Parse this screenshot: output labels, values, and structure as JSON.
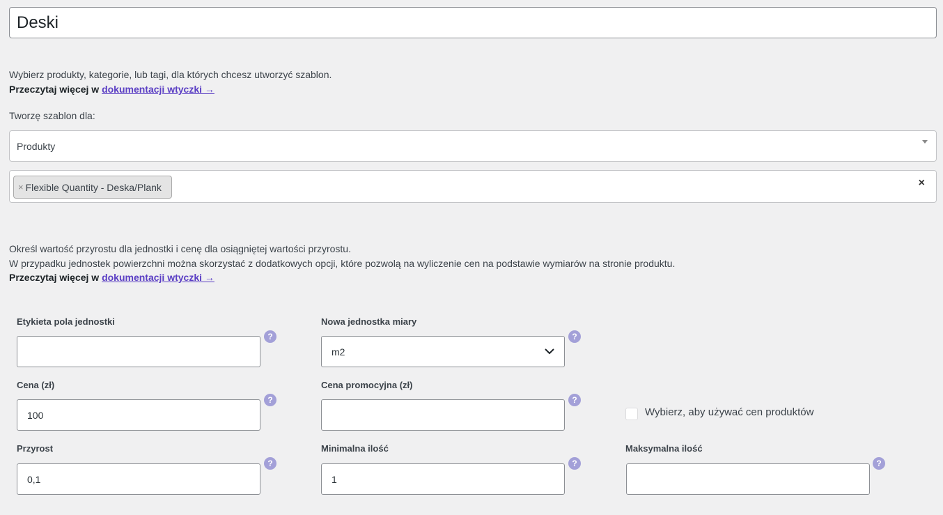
{
  "title_value": "Deski",
  "intro": {
    "line1": "Wybierz produkty, kategorie, lub tagi, dla których chcesz utworzyć szablon.",
    "read_more_prefix": "Przeczytaj więcej w",
    "read_more_link": "dokumentacji wtyczki →"
  },
  "template_for_label": "Tworzę szablon dla:",
  "template_for_select": "Produkty",
  "tags": {
    "items": [
      "Flexible Quantity - Deska/Plank"
    ],
    "remove_glyph": "×",
    "clear_glyph": "×"
  },
  "increment_info": {
    "line1": "Określ wartość przyrostu dla jednostki i cenę dla osiągniętej wartości przyrostu.",
    "line2": "W przypadku jednostek powierzchni można skorzystać z dodatkowych opcji, które pozwolą na wyliczenie cen na podstawie wymiarów na stronie produktu.",
    "read_more_prefix": "Przeczytaj więcej w",
    "read_more_link": "dokumentacji wtyczki →"
  },
  "fields": {
    "unit_label": {
      "label": "Etykieta pola jednostki",
      "value": ""
    },
    "new_unit": {
      "label": "Nowa jednostka miary",
      "value": "m2"
    },
    "price": {
      "label": "Cena (zł)",
      "value": "100"
    },
    "sale_price": {
      "label": "Cena promocyjna (zł)",
      "value": ""
    },
    "use_product_prices": {
      "label": "Wybierz, aby używać cen produktów",
      "checked": false
    },
    "increment": {
      "label": "Przyrost",
      "value": "0,1"
    },
    "min_qty": {
      "label": "Minimalna ilość",
      "value": "1"
    },
    "max_qty": {
      "label": "Maksymalna ilość",
      "value": ""
    }
  },
  "help_glyph": "?"
}
